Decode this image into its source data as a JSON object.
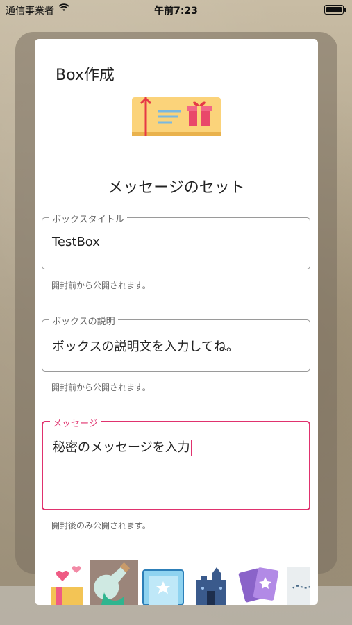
{
  "status_bar": {
    "carrier": "通信事業者",
    "time": "午前7:23"
  },
  "dialog": {
    "title": "Box作成",
    "section_title": "メッセージのセット",
    "fields": [
      {
        "label": "ボックスタイトル",
        "value": "TestBox",
        "helper": "開封前から公開されます。"
      },
      {
        "label": "ボックスの説明",
        "value": "ボックスの説明文を入力してね。",
        "helper": "開封前から公開されます。"
      },
      {
        "label": "メッセージ",
        "value": "秘密のメッセージを入力",
        "helper": "開封後のみ公開されます。"
      }
    ],
    "active_field_color": "#e0326e",
    "thumbnails": [
      "hearts-gift-icon",
      "potion-bottle-icon",
      "ticket-icon",
      "castle-icon",
      "magic-cards-icon",
      "treasure-map-icon"
    ]
  }
}
